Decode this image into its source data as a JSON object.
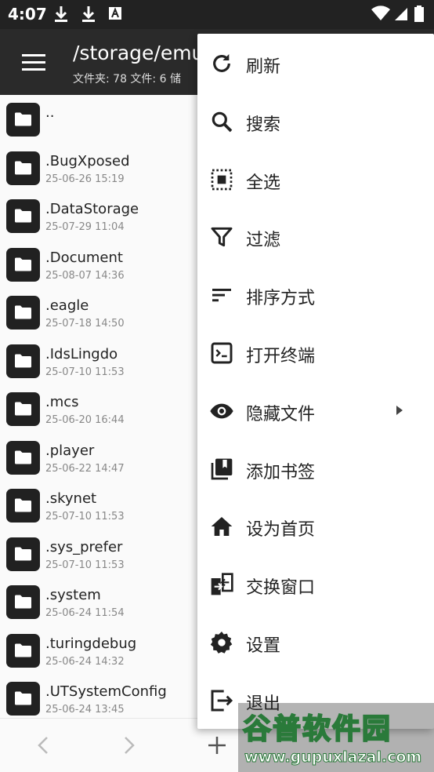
{
  "status_bar": {
    "time": "4:07",
    "icons": [
      "download-icon",
      "download-icon",
      "a-notification-icon",
      "wifi-icon",
      "signal-icon",
      "battery-icon"
    ]
  },
  "toolbar": {
    "path": "/storage/emu",
    "subtitle": "文件夹: 78  文件: 6  储"
  },
  "files": [
    {
      "name": "..",
      "date": ""
    },
    {
      "name": ".BugXposed",
      "date": "25-06-26 15:19"
    },
    {
      "name": ".DataStorage",
      "date": "25-07-29 11:04"
    },
    {
      "name": ".Document",
      "date": "25-08-07 14:36"
    },
    {
      "name": ".eagle",
      "date": "25-07-18 14:50"
    },
    {
      "name": ".IdsLingdo",
      "date": "25-07-10 11:53"
    },
    {
      "name": ".mcs",
      "date": "25-06-20 16:44"
    },
    {
      "name": ".player",
      "date": "25-06-22 14:47"
    },
    {
      "name": ".skynet",
      "date": "25-07-10 11:53"
    },
    {
      "name": ".sys_prefer",
      "date": "25-07-10 11:53"
    },
    {
      "name": ".system",
      "date": "25-06-24 11:54"
    },
    {
      "name": ".turingdebug",
      "date": "25-06-24 14:32"
    },
    {
      "name": ".UTSystemConfig",
      "date": "25-06-24 13:45"
    }
  ],
  "menu": [
    {
      "label": "刷新",
      "icon": "refresh-icon"
    },
    {
      "label": "搜索",
      "icon": "search-icon"
    },
    {
      "label": "全选",
      "icon": "select-all-icon"
    },
    {
      "label": "过滤",
      "icon": "filter-icon"
    },
    {
      "label": "排序方式",
      "icon": "sort-icon"
    },
    {
      "label": "打开终端",
      "icon": "terminal-icon"
    },
    {
      "label": "隐藏文件",
      "icon": "eye-icon"
    },
    {
      "label": "添加书签",
      "icon": "bookmark-icon"
    },
    {
      "label": "设为首页",
      "icon": "home-icon"
    },
    {
      "label": "交换窗口",
      "icon": "swap-window-icon"
    },
    {
      "label": "设置",
      "icon": "gear-icon"
    },
    {
      "label": "退出",
      "icon": "exit-icon"
    }
  ],
  "watermark": {
    "logo_text": "谷普软件园",
    "url": "www.gupuxlazal.com"
  }
}
